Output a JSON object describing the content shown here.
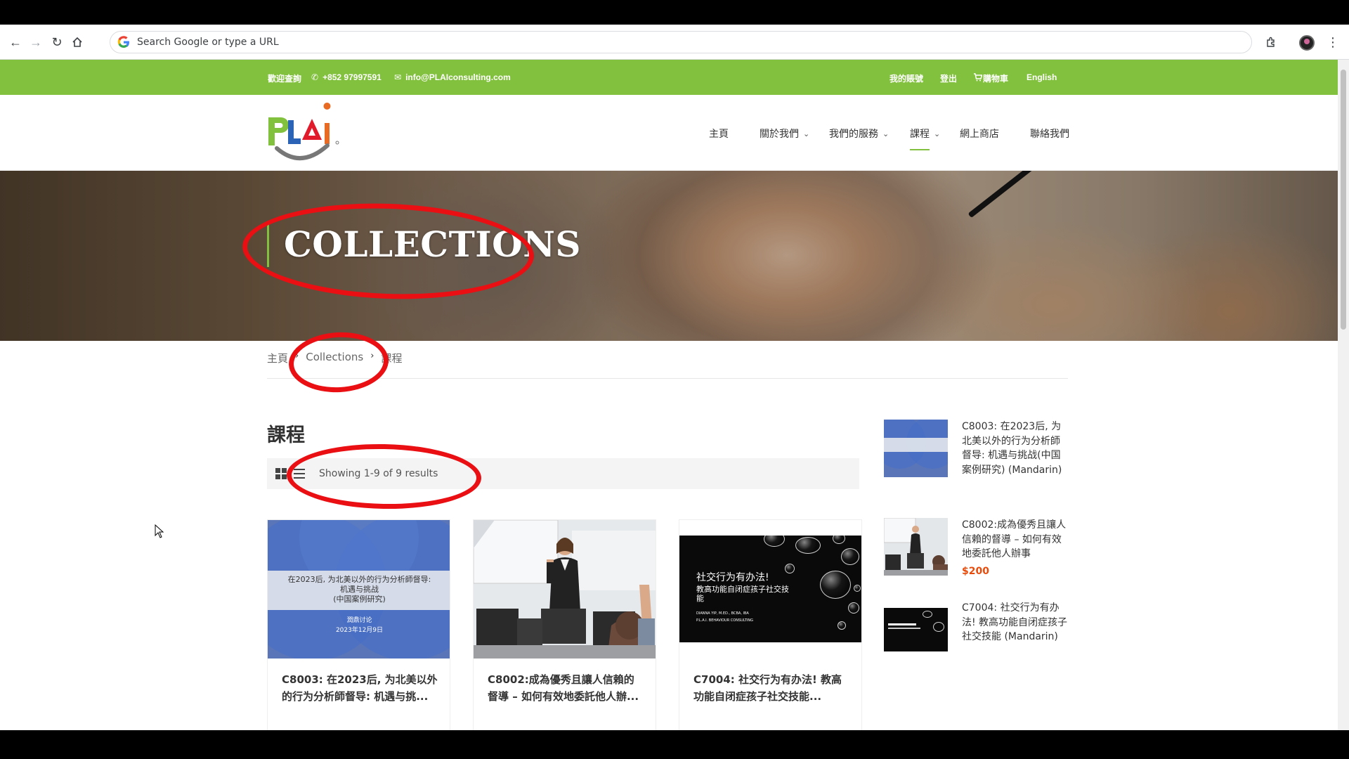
{
  "browser": {
    "omnibox_placeholder": "Search Google or type a URL",
    "icons": [
      "back-icon",
      "forward-icon",
      "reload-icon",
      "home-icon",
      "google-g-icon",
      "extensions-icon",
      "profile-avatar",
      "menu-dots-icon"
    ]
  },
  "topbar": {
    "welcome": "歡迎查詢",
    "phone": "+852 97997591",
    "email": "info@PLAIconsulting.com",
    "account": "我的賬號",
    "logout": "登出",
    "cart": "購物車",
    "language": "English",
    "bg_color": "#82c13d"
  },
  "nav": {
    "home": "主頁",
    "about": "關於我們",
    "services": "我們的服務",
    "courses": "課程",
    "shop": "網上商店",
    "contact": "聯絡我們"
  },
  "hero": {
    "title": "COLLECTIONS"
  },
  "breadcrumb": {
    "home": "主頁",
    "collections": "Collections",
    "current": "課程"
  },
  "main": {
    "heading": "課程",
    "results": "Showing 1-9 of 9 results"
  },
  "products": [
    {
      "title": "C8003: 在2023后, 为北美以外的行为分析師督导: 机遇与挑...",
      "image": {
        "line1": "在2023后, 为北美以外的行为分析師督导:",
        "line2": "机遇与挑战",
        "line3": "(中国案例研究)",
        "sub1": "潤鼎讨论",
        "sub2": "2023年12月9日"
      }
    },
    {
      "title": "C8002:成為優秀且讓人信賴的督導 – 如何有效地委託他人辦..."
    },
    {
      "title": "C7004: 社交行为有办法! 教高功能自闭症孩子社交技能...",
      "image": {
        "line1": "社交行为有办法!",
        "line2": "教高功能自闭症孩子社交技能",
        "author": "DIANNA YIP, M.ED., BCBA, IBA",
        "org": "P.L.A.I. BEHAVIOUR CONSULTING"
      }
    }
  ],
  "sidebar": [
    {
      "title": "C8003: 在2023后, 为北美以外的行为分析師督导: 机遇与挑战(中国案例研究) (Mandarin)"
    },
    {
      "title": "C8002:成為優秀且讓人信賴的督導 – 如何有效地委託他人辦事",
      "price": "$200"
    },
    {
      "title": "C7004: 社交行为有办法! 教高功能自闭症孩子社交技能 (Mandarin)"
    }
  ],
  "colors": {
    "accent_green": "#82c13d",
    "annotation_red": "#ea0f13",
    "price_orange": "#e74c0c"
  }
}
